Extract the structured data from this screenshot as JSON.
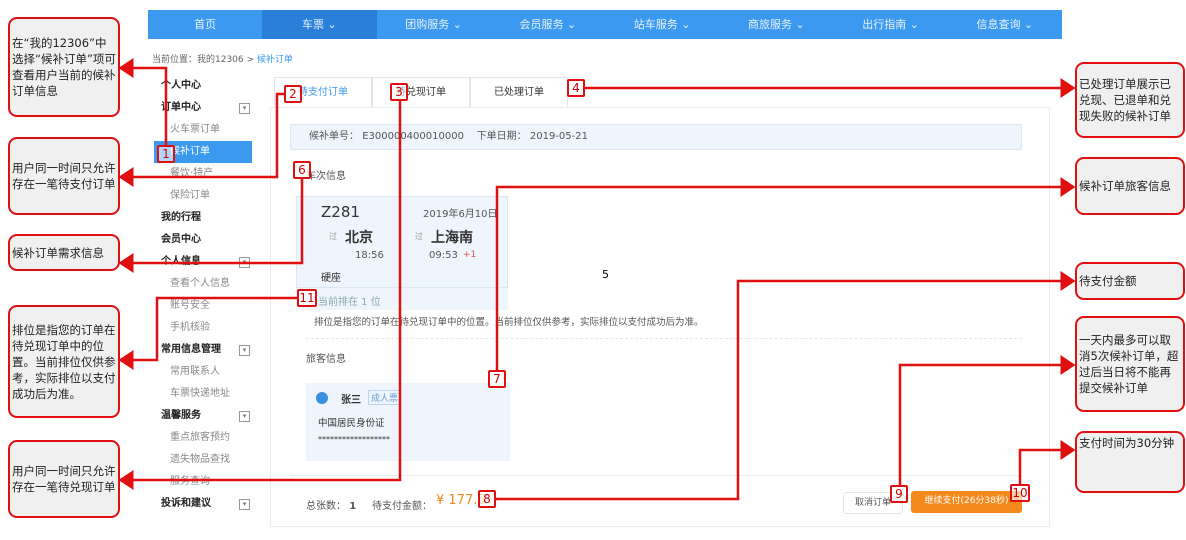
{
  "nav": [
    "首页",
    "车票 ⌄",
    "团购服务 ⌄",
    "会员服务 ⌄",
    "站车服务 ⌄",
    "商旅服务 ⌄",
    "出行指南 ⌄",
    "信息查询 ⌄"
  ],
  "breadcrumb": {
    "prefix": "当前位置：我的12306 > ",
    "current": "候补订单"
  },
  "sidebar": [
    {
      "label": "个人中心",
      "type": "head"
    },
    {
      "label": "订单中心",
      "type": "head",
      "toggle": true
    },
    {
      "label": "火车票订单",
      "type": "item"
    },
    {
      "label": "候补订单",
      "type": "sel"
    },
    {
      "label": "餐饮·特产",
      "type": "item"
    },
    {
      "label": "保险订单",
      "type": "item"
    },
    {
      "label": "我的行程",
      "type": "head"
    },
    {
      "label": "会员中心",
      "type": "head"
    },
    {
      "label": "个人信息",
      "type": "head",
      "toggle": true
    },
    {
      "label": "查看个人信息",
      "type": "item"
    },
    {
      "label": "账号安全",
      "type": "item"
    },
    {
      "label": "手机核验",
      "type": "item"
    },
    {
      "label": "常用信息管理",
      "type": "head",
      "toggle": true
    },
    {
      "label": "常用联系人",
      "type": "item"
    },
    {
      "label": "车票快递地址",
      "type": "item"
    },
    {
      "label": "温馨服务",
      "type": "head",
      "toggle": true
    },
    {
      "label": "重点旅客预约",
      "type": "item"
    },
    {
      "label": "遗失物品查找",
      "type": "item"
    },
    {
      "label": "服务查询",
      "type": "item"
    },
    {
      "label": "投诉和建议",
      "type": "head",
      "toggle": true
    }
  ],
  "tabs": [
    "待支付订单",
    "待兑现订单",
    "已处理订单"
  ],
  "order": {
    "no_label": "候补单号：",
    "no": "E300000400010000",
    "date_label": "下单日期：",
    "date": "2019-05-21"
  },
  "trip": {
    "section": "车次信息",
    "train": "Z281",
    "date": "2019年6月10日",
    "from": "北京",
    "to": "上海南",
    "via": "过",
    "dep": "18:56",
    "arr": "09:53",
    "plus": "+1",
    "seat": "硬座",
    "queue": "当前排在 1 位",
    "note": "排位是指您的订单在待兑现订单中的位置。当前排位仅供参考，实际排位以支付成功后为准。"
  },
  "passenger": {
    "section": "旅客信息",
    "name": "张三",
    "type": "成人票",
    "id_type": "中国居民身份证",
    "id": "******************"
  },
  "footer": {
    "count_label": "总张数：",
    "count": "1",
    "amount_label": "待支付金额：",
    "amount": "¥ 177.5",
    "cancel": "取消订单",
    "pay": "继续支付(26分38秒)"
  },
  "marker5": "5",
  "markers": [
    "1",
    "2",
    "3",
    "4",
    "6",
    "7",
    "8",
    "9",
    "10",
    "11"
  ],
  "callouts_left": [
    "在“我的12306”中选择“候补订单”项可查看用户当前的候补订单信息",
    "用户同一时间只允许存在一笔待支付订单",
    "候补订单需求信息",
    "排位是指您的订单在待兑现订单中的位置。当前排位仅供参考，实际排位以支付成功后为准。",
    "用户同一时间只允许存在一笔待兑现订单"
  ],
  "callouts_right": [
    "已处理订单展示已兑现、已退单和兑现失败的候补订单",
    "候补订单旅客信息",
    "待支付金额",
    "一天内最多可以取消5次候补订单，超过后当日将不能再提交候补订单",
    "支付时间为30分钟"
  ]
}
